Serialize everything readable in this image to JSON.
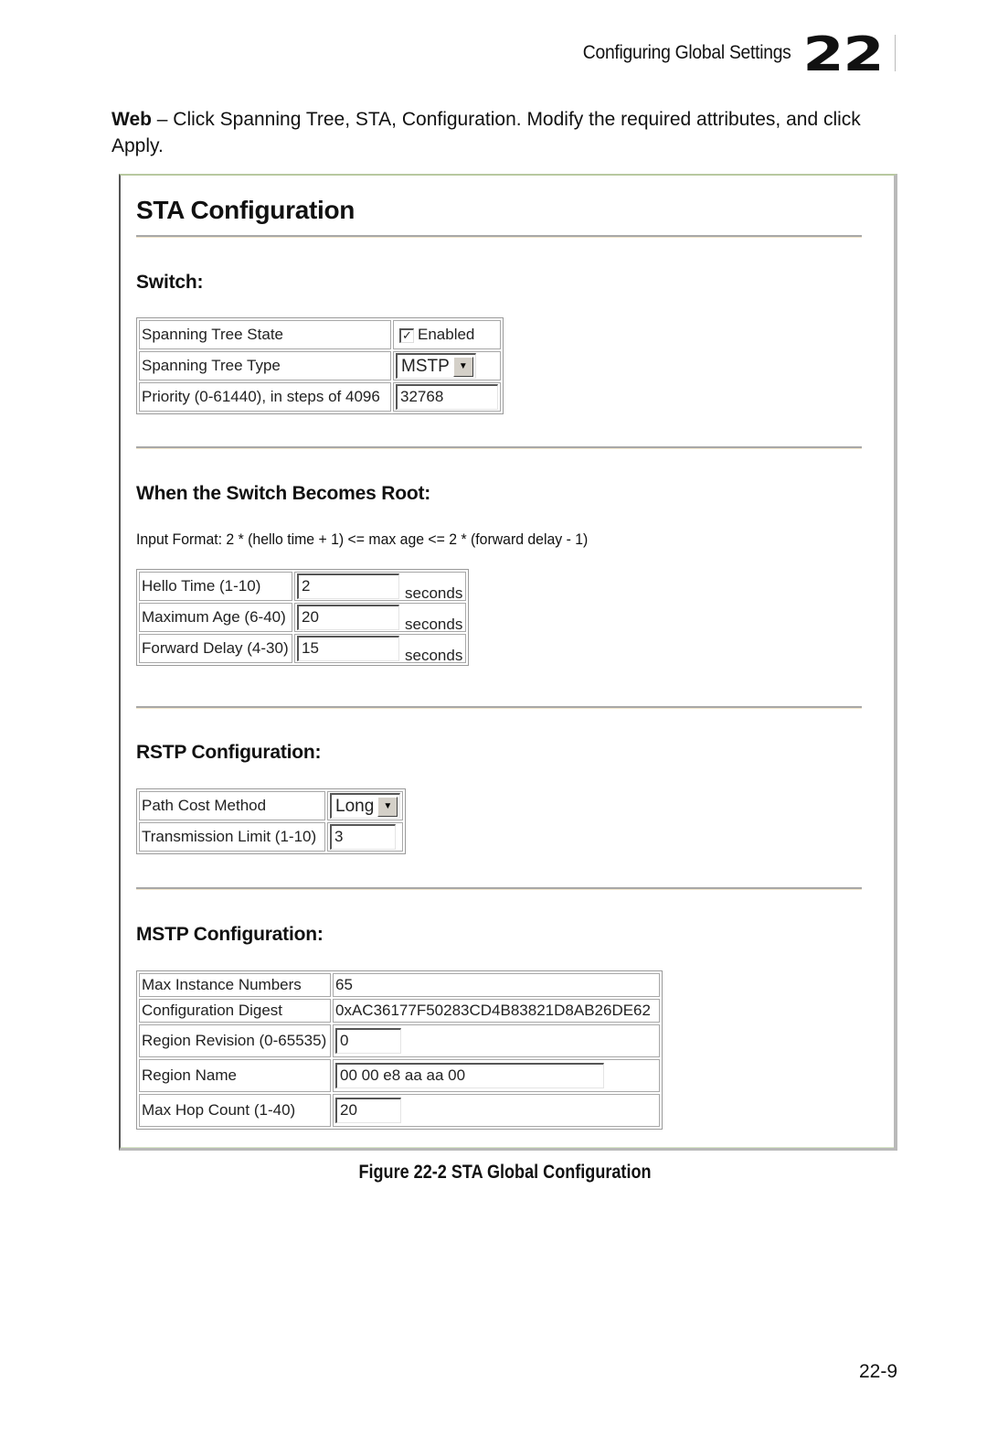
{
  "running_head": {
    "title": "Configuring Global Settings",
    "chapter_number": "22"
  },
  "intro": {
    "lead": "Web",
    "text": " – Click Spanning Tree, STA, Configuration. Modify the required attributes, and click Apply."
  },
  "screen": {
    "title": "STA Configuration",
    "switch": {
      "heading": "Switch:",
      "spanning_tree_state": {
        "label": "Spanning Tree State",
        "checked": true,
        "checkbox_label": "Enabled"
      },
      "spanning_tree_type": {
        "label": "Spanning Tree Type",
        "value": "MSTP"
      },
      "priority": {
        "label": "Priority (0-61440), in steps of 4096",
        "value": "32768"
      }
    },
    "root": {
      "heading": "When the Switch Becomes Root:",
      "input_format": "Input Format: 2 * (hello time + 1) <= max age <= 2 * (forward delay - 1)",
      "rows": [
        {
          "label": "Hello Time (1-10)",
          "value": "2",
          "unit": "seconds"
        },
        {
          "label": "Maximum Age (6-40)",
          "value": "20",
          "unit": "seconds"
        },
        {
          "label": "Forward Delay (4-30)",
          "value": "15",
          "unit": "seconds"
        }
      ]
    },
    "rstp": {
      "heading": "RSTP Configuration:",
      "path_cost_method": {
        "label": "Path Cost Method",
        "value": "Long"
      },
      "transmission_limit": {
        "label": "Transmission Limit (1-10)",
        "value": "3"
      }
    },
    "mstp": {
      "heading": "MSTP Configuration:",
      "max_instance_numbers": {
        "label": "Max Instance Numbers",
        "value": "65"
      },
      "configuration_digest": {
        "label": "Configuration Digest",
        "value": "0xAC36177F50283CD4B83821D8AB26DE62"
      },
      "region_revision": {
        "label": "Region Revision (0-65535)",
        "value": "0"
      },
      "region_name": {
        "label": "Region Name",
        "value": "00 00 e8 aa aa 00"
      },
      "max_hop_count": {
        "label": "Max Hop Count (1-40)",
        "value": "20"
      }
    }
  },
  "caption": "Figure 22-2  STA Global Configuration",
  "folio": "22-9"
}
